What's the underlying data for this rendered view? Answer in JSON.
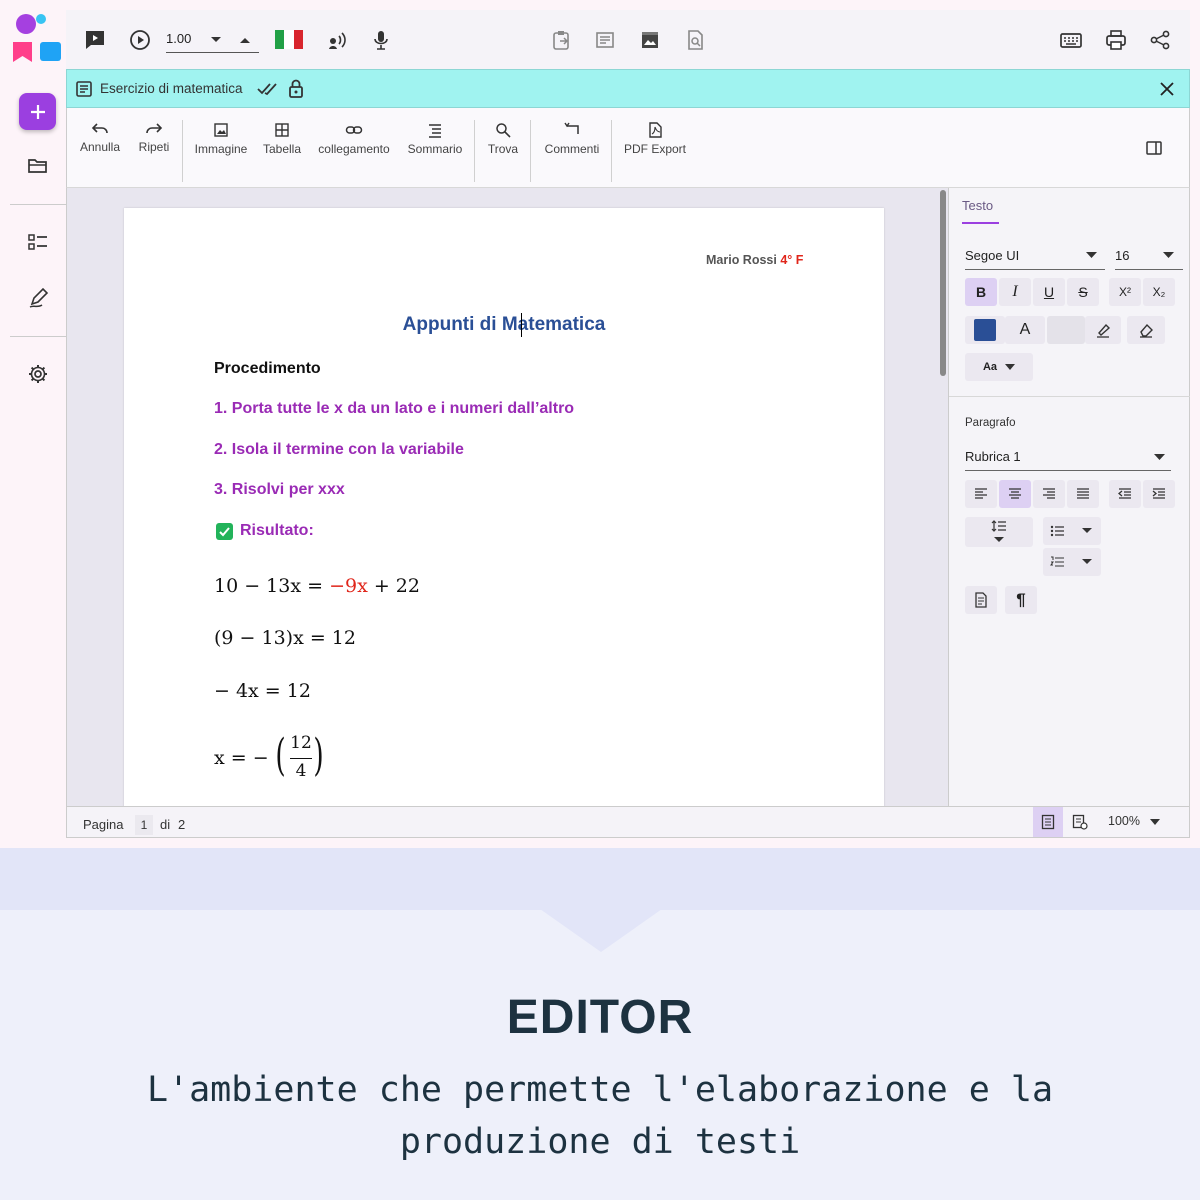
{
  "toolbar": {
    "speed": "1.00"
  },
  "docbar": {
    "title": "Esercizio di matematica"
  },
  "ribbon": {
    "undo": "Annulla",
    "redo": "Ripeti",
    "image": "Immagine",
    "table": "Tabella",
    "link": "collegamento",
    "toc": "Sommario",
    "find": "Trova",
    "comments": "Commenti",
    "pdf": "PDF Export"
  },
  "document": {
    "author": "Mario Rossi",
    "class_label": "4° F",
    "title": "Appunti di Matematica",
    "heading": "Procedimento",
    "steps": [
      "1. Porta tutte le x da un lato e i numeri dall’altro",
      "2. Isola il termine con la variabile",
      "3. Risolvi per xxx"
    ],
    "result_label": "Risultato:",
    "eq1_left": "10 − 13x = ",
    "eq1_red": "−9x",
    "eq1_right": " + 22",
    "eq2": "(9 − 13)x = 12",
    "eq3": "− 4x = 12",
    "eq4_left": "x = −",
    "eq4_num": "12",
    "eq4_den": "4"
  },
  "sidebar": {
    "tab": "Testo",
    "font": "Segoe UI",
    "size": "16",
    "bold": "B",
    "italic": "I",
    "underline": "U",
    "strike": "S",
    "sup": "X²",
    "sub": "X₂",
    "font_color_label": "A",
    "case_label": "Aa",
    "paragraph_label": "Paragrafo",
    "style": "Rubrica 1",
    "pilcrow": "¶"
  },
  "status": {
    "page_label": "Pagina",
    "page": "1",
    "of_label": "di",
    "total": "2",
    "zoom": "100%"
  },
  "banner": {
    "title": "EDITOR",
    "subtitle": "L'ambiente che permette l'elaborazione e la produzione di testi"
  },
  "colors": {
    "accent": "#9b3fe0",
    "docbar": "#a0f3f0",
    "title_blue": "#2a4f96",
    "step_purple": "#9a2bb5",
    "red": "#e0261b",
    "check_green": "#22b35a",
    "banner_text": "#1d3240"
  },
  "icons": [
    "logo-icon",
    "plus-icon",
    "folder-icon",
    "list-icon",
    "pen-icon",
    "gear-icon",
    "play-speech-icon",
    "play-icon",
    "chevron-down-icon",
    "chevron-up-icon",
    "italian-flag-icon",
    "voice-icon",
    "mic-icon",
    "clipboard-icon",
    "text-icon",
    "image-icon",
    "search-doc-icon",
    "keyboard-icon",
    "print-icon",
    "share-icon",
    "document-icon",
    "double-check-icon",
    "lock-icon",
    "close-icon",
    "undo-icon",
    "redo-icon",
    "table-icon",
    "link-icon",
    "toc-icon",
    "search-icon",
    "comment-icon",
    "pdf-icon",
    "panel-icon"
  ]
}
